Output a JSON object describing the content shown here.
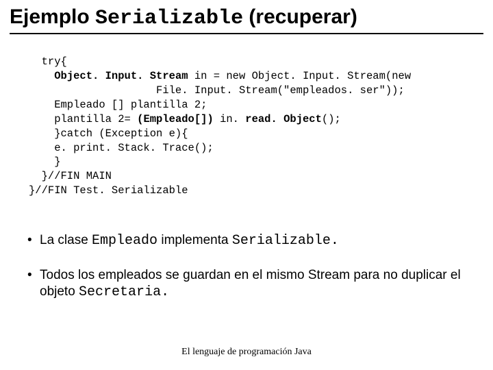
{
  "title": {
    "pre": "Ejemplo ",
    "mono": "Serializable",
    "post": " (recuperar)"
  },
  "code": {
    "l1": "  try{",
    "l2a": "    ",
    "l2b": "Object. Input. Stream",
    "l2c": " in = new Object. Input. Stream(new",
    "l3": "                    File. Input. Stream(\"empleados. ser\"));",
    "l4": "    Empleado [] plantilla 2;",
    "l5a": "    plantilla 2= ",
    "l5b": "(Empleado[])",
    "l5c": " in. ",
    "l5d": "read. Object",
    "l5e": "();",
    "l6": "    }catch (Exception e){",
    "l7": "    e. print. Stack. Trace();",
    "l8": "    }",
    "l9": "  }//FIN MAIN",
    "l10": "}//FIN Test. Serializable"
  },
  "bullets": {
    "b1a": "La clase ",
    "b1b": "Empleado",
    "b1c": " implementa ",
    "b1d": "Serializable.",
    "b2a": "Todos los empleados se guardan en el mismo Stream para no duplicar el objeto ",
    "b2b": "Secretaria."
  },
  "footer": "El lenguaje de programación Java"
}
